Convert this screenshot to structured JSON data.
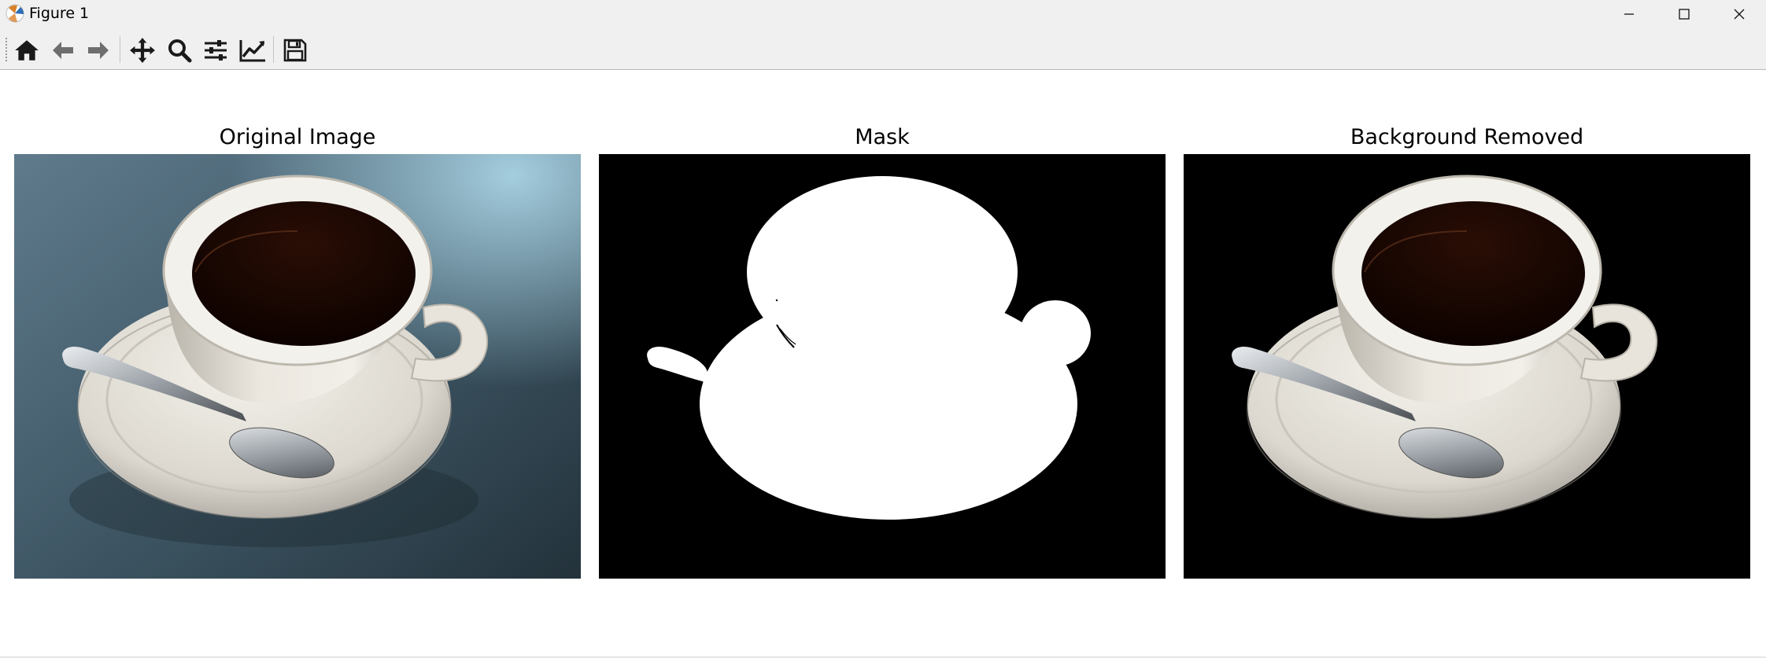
{
  "window": {
    "title": "Figure 1",
    "controls": [
      "minimize",
      "maximize",
      "close"
    ]
  },
  "toolbar": {
    "buttons": [
      {
        "name": "home",
        "icon": "home-icon"
      },
      {
        "name": "back",
        "icon": "arrow-left-icon"
      },
      {
        "name": "forward",
        "icon": "arrow-right-icon"
      },
      {
        "name": "pan",
        "icon": "move-icon"
      },
      {
        "name": "zoom",
        "icon": "magnifier-icon"
      },
      {
        "name": "configure-subplots",
        "icon": "sliders-icon"
      },
      {
        "name": "edit-axis",
        "icon": "line-chart-icon"
      },
      {
        "name": "save",
        "icon": "floppy-disk-icon"
      }
    ]
  },
  "figure": {
    "panels": [
      {
        "title": "Original Image",
        "content": "coffee cup on saucer with spoon, blue-grey background"
      },
      {
        "title": "Mask",
        "content": "white cup silhouette on black"
      },
      {
        "title": "Background Removed",
        "content": "coffee cup on saucer with spoon, black background"
      }
    ]
  },
  "colors": {
    "chrome": "#f0f0f0",
    "icon": "#1a1a1a",
    "icon_disabled": "#6e6e6e",
    "mask_fg": "#ffffff",
    "mask_bg": "#000000"
  }
}
